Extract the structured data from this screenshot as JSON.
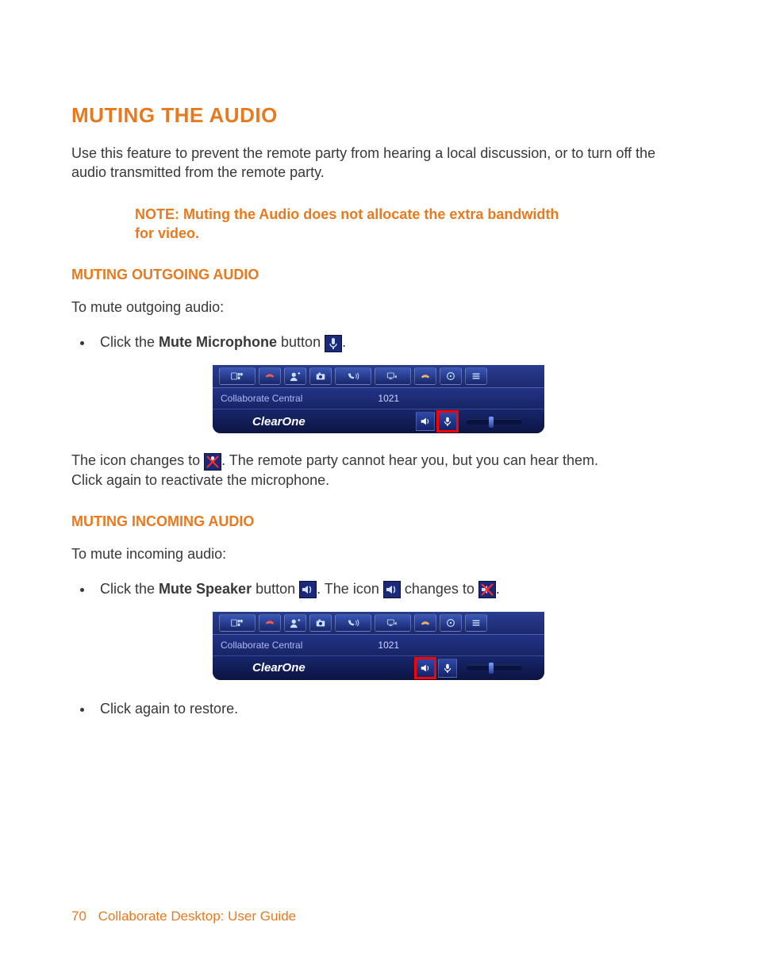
{
  "title": "MUTING THE AUDIO",
  "intro": "Use this feature to prevent the remote party from hearing a local discussion, or to turn off the audio transmitted from the remote party.",
  "note_label": "NOTE:",
  "note_text": " Muting the Audio does not allocate the extra bandwidth for video.",
  "outgoing": {
    "heading": "MUTING OUTGOING AUDIO",
    "intro": "To mute outgoing audio:",
    "step_prefix": "Click the ",
    "step_bold": "Mute Microphone",
    "step_suffix": " button ",
    "step_period": ".",
    "after1": ". The remote party cannot hear you, but you can hear them.",
    "after_prefix": "The icon changes to ",
    "after2": "Click again to reactivate the microphone."
  },
  "incoming": {
    "heading": "MUTING INCOMING AUDIO",
    "intro": "To mute incoming audio:",
    "step_prefix": "Click the ",
    "step_bold": "Mute Speaker",
    "step_suffix": " button ",
    "mid1": ". The icon ",
    "mid2": " changes to ",
    "period": ".",
    "restore": "Click again to restore."
  },
  "ui": {
    "label": "Collaborate Central",
    "number": "1021",
    "brand": "ClearOne"
  },
  "footer": {
    "page": "70",
    "book": "Collaborate Desktop: User Guide"
  }
}
